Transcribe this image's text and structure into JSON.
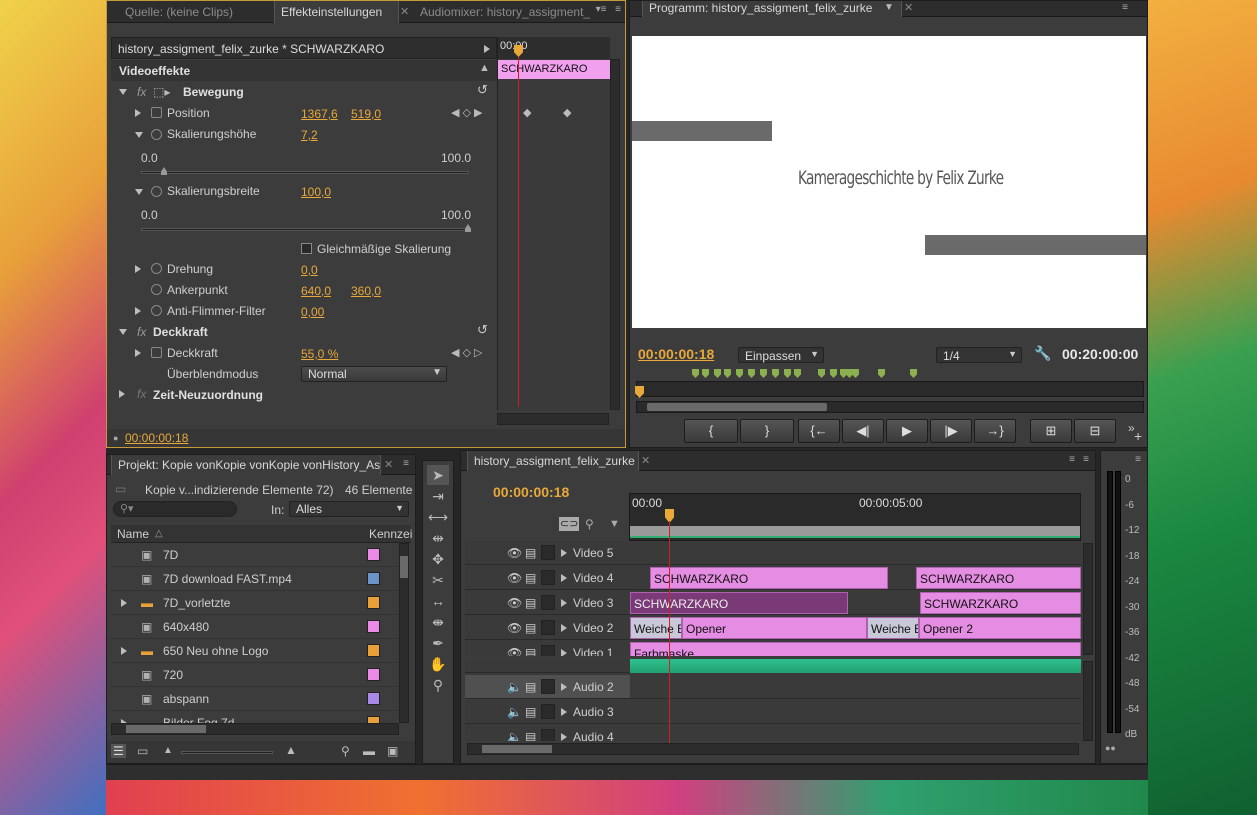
{
  "source_panel": {
    "tab_quelle": "Quelle: (keine Clips)",
    "tab_effects": "Effekteinstellungen",
    "tab_audiomixer": "Audiomixer: history_assigment_",
    "sequence_title": "history_assigment_felix_zurke * SCHWARZKARO",
    "mini_time": "00:00",
    "mini_clip": "SCHWARZKARO",
    "video_effects": "Videoeffekte",
    "bewegung": "Bewegung",
    "position_label": "Position",
    "position_x": "1367,6",
    "position_y": "519,0",
    "skal_hoehe_label": "Skalierungshöhe",
    "skal_hoehe_val": "7,2",
    "range1_min": "0.0",
    "range1_max": "100.0",
    "skal_breite_label": "Skalierungsbreite",
    "skal_breite_val": "100,0",
    "range2_min": "0.0",
    "range2_max": "100.0",
    "uniform_scale": "Gleichmäßige Skalierung",
    "drehung_label": "Drehung",
    "drehung_val": "0,0",
    "anker_label": "Ankerpunkt",
    "anker_x": "640,0",
    "anker_y": "360,0",
    "flimmer_label": "Anti-Flimmer-Filter",
    "flimmer_val": "0,00",
    "deckkraft_group": "Deckkraft",
    "deckkraft_label": "Deckkraft",
    "deckkraft_val": "55,0 %",
    "blend_label": "Überblendmodus",
    "blend_val": "Normal",
    "zeit": "Zeit-Neuzuordnung",
    "timecode": "00:00:00:18"
  },
  "program": {
    "tab": "Programm: history_assigment_felix_zurke",
    "title_text": "Kamerageschichte by Felix Zurke",
    "timecode": "00:00:00:18",
    "fit": "Einpassen",
    "resolution": "1/4",
    "duration": "00:20:00:00"
  },
  "project": {
    "tab": "Projekt: Kopie vonKopie vonKopie vonHistory_As",
    "summary": "Kopie v...indizierende Elemente 72)",
    "count": "46 Elemente",
    "in_label": "In:",
    "in_value": "Alles",
    "col_name": "Name",
    "col_label": "Kennzei",
    "items": [
      {
        "name": "7D",
        "color": "#e88ae6"
      },
      {
        "name": "7D download FAST.mp4",
        "color": "#6a94c8"
      },
      {
        "name": "7D_vorletzte",
        "color": "#e8a03a"
      },
      {
        "name": "640x480",
        "color": "#e88ae6"
      },
      {
        "name": "650 Neu ohne Logo",
        "color": "#e8a03a"
      },
      {
        "name": "720",
        "color": "#e88ae6"
      },
      {
        "name": "abspann",
        "color": "#a88ae6"
      },
      {
        "name": "Bilder Fog 7d",
        "color": "#e8a03a"
      }
    ]
  },
  "timeline": {
    "tab": "history_assigment_felix_zurke",
    "timecode": "00:00:00:18",
    "ruler_start": "00:00",
    "ruler_mid": "00:00:05:00",
    "tracks": [
      "Video 5",
      "Video 4",
      "Video 3",
      "Video 2",
      "Video 1",
      "Audio 2",
      "Audio 3",
      "Audio 4"
    ],
    "clip_v4a": "SCHWARZKARO",
    "clip_v4b": "SCHWARZKARO",
    "clip_v3a": "SCHWARZKARO",
    "clip_v3b": "SCHWARZKARO",
    "clip_v2a": "Weiche B",
    "clip_v2b": "Opener",
    "clip_v2c": "Weiche B",
    "clip_v2d": "Opener 2",
    "clip_v1": "Farbmaske"
  },
  "meter": {
    "labels": [
      "0",
      "-6",
      "-12",
      "-18",
      "-24",
      "-30",
      "-36",
      "-42",
      "-48",
      "-54",
      "dB"
    ]
  }
}
